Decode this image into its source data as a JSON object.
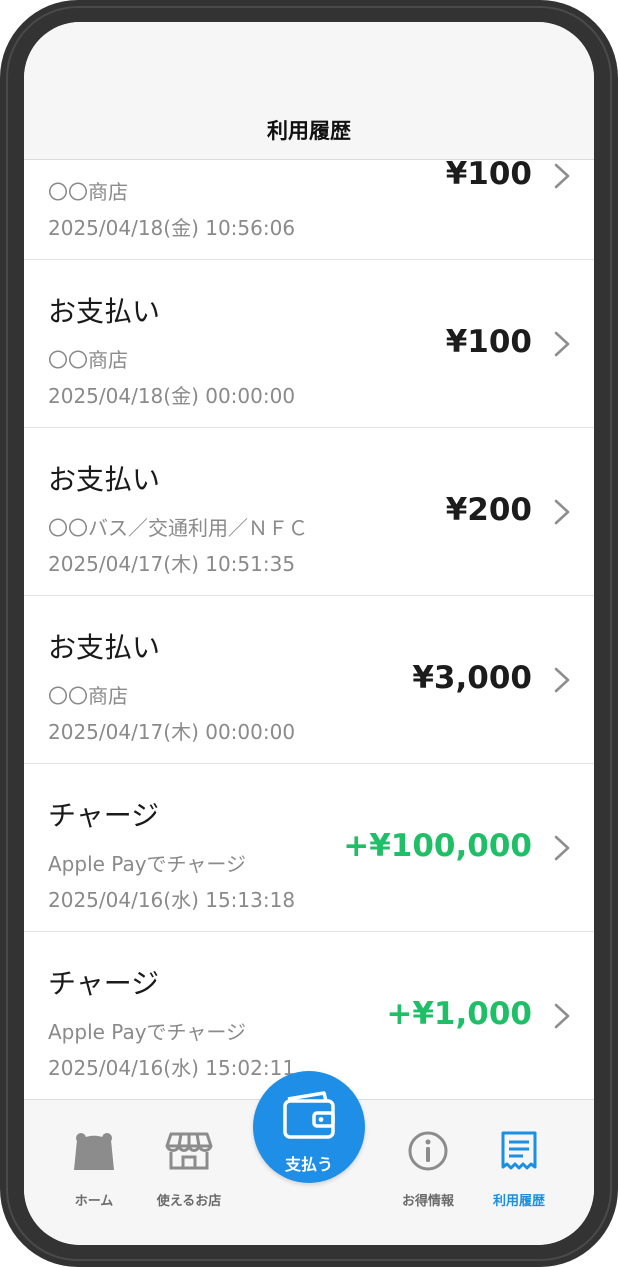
{
  "header": {
    "title": "利用履歴"
  },
  "transactions": [
    {
      "title": "",
      "merchant": "〇〇商店",
      "date": "2025/04/18(金) 10:56:06",
      "amount": "¥100",
      "type": "payment"
    },
    {
      "title": "お支払い",
      "merchant": "〇〇商店",
      "date": "2025/04/18(金) 00:00:00",
      "amount": "¥100",
      "type": "payment"
    },
    {
      "title": "お支払い",
      "merchant": "〇〇バス／交通利用／ＮＦＣ",
      "date": "2025/04/17(木) 10:51:35",
      "amount": "¥200",
      "type": "payment"
    },
    {
      "title": "お支払い",
      "merchant": "〇〇商店",
      "date": "2025/04/17(木) 00:00:00",
      "amount": "¥3,000",
      "type": "payment"
    },
    {
      "title": "チャージ",
      "merchant": "Apple Payでチャージ",
      "date": "2025/04/16(水) 15:13:18",
      "amount": "+¥100,000",
      "type": "charge"
    },
    {
      "title": "チャージ",
      "merchant": "Apple Payでチャージ",
      "date": "2025/04/16(水) 15:02:11",
      "amount": "+¥1,000",
      "type": "charge"
    }
  ],
  "tabbar": {
    "items": [
      {
        "label": "ホーム",
        "icon": "home-icon",
        "active": false
      },
      {
        "label": "使えるお店",
        "icon": "store-icon",
        "active": false
      },
      {
        "label": "お得情報",
        "icon": "info-icon",
        "active": false
      },
      {
        "label": "利用履歴",
        "icon": "receipt-icon",
        "active": true
      }
    ],
    "pay": {
      "label": "支払う",
      "icon": "wallet-icon"
    }
  },
  "colors": {
    "accent": "#1f8ee6",
    "active_tab": "#1a8fe3",
    "charge_amount": "#1fbf67",
    "inactive_tab": "#6b6b6b"
  }
}
